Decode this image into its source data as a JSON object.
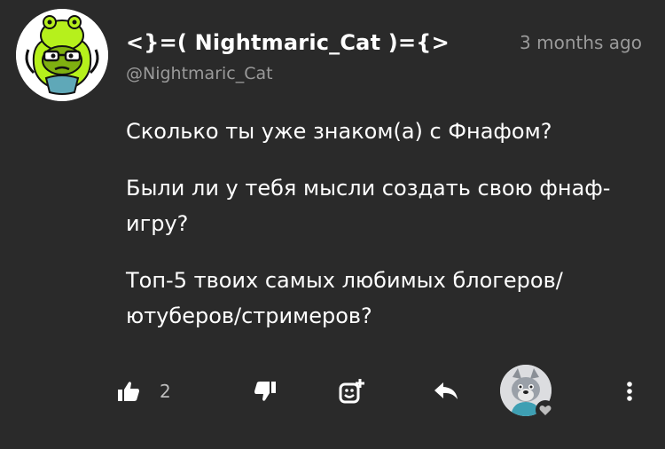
{
  "comment": {
    "author_name": "<}=( Nightmaric_Cat )={>",
    "author_handle": "@Nightmaric_Cat",
    "timestamp": "3 months ago",
    "paragraphs": [
      "Сколько ты уже знаком(а) с Фнафом?",
      "Были ли у тебя мысли создать свою фнаф-игру?",
      "Топ-5 твоих самых любимых блогеров/ютуберов/стримеров?"
    ]
  },
  "actions": {
    "like_count": "2",
    "icons": {
      "like": "thumbs-up-icon",
      "dislike": "thumbs-down-icon",
      "emoji": "add-emoji-icon",
      "reply": "reply-arrow-icon",
      "creator_heart": "heart-icon",
      "more": "more-vertical-icon"
    }
  },
  "colors": {
    "background": "#2a2a2a",
    "text_primary": "#ffffff",
    "text_secondary": "#9a9a9a",
    "avatar_green": "#b6f01c"
  }
}
